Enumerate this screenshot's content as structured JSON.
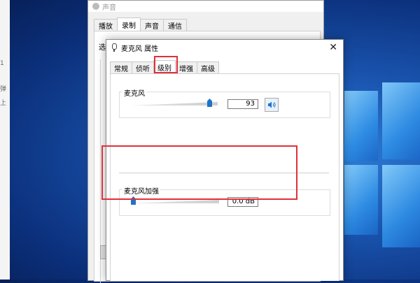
{
  "desktop": {
    "left_stub_text": [
      "1",
      "弹",
      "上"
    ]
  },
  "sound_window": {
    "title": "声音",
    "tabs": [
      {
        "label": "播放",
        "active": false
      },
      {
        "label": "录制",
        "active": true
      },
      {
        "label": "声音",
        "active": false
      },
      {
        "label": "通信",
        "active": false
      }
    ],
    "body_stub_text": "选"
  },
  "mic_dialog": {
    "title": "麦克风 属性",
    "close_glyph": "✕",
    "tabs": [
      {
        "label": "常规",
        "active": false
      },
      {
        "label": "侦听",
        "active": false
      },
      {
        "label": "级别",
        "active": true
      },
      {
        "label": "增强",
        "active": false
      },
      {
        "label": "高级",
        "active": false
      }
    ],
    "microphone": {
      "label": "麦克风",
      "value_text": "93",
      "level": 0.93,
      "mute_icon": "speaker-icon"
    },
    "boost": {
      "label": "麦克风加强",
      "value_text": "0.0 dB",
      "level": 0.0
    }
  },
  "colors": {
    "highlight": "#e0303b",
    "accent": "#1e73c9"
  }
}
